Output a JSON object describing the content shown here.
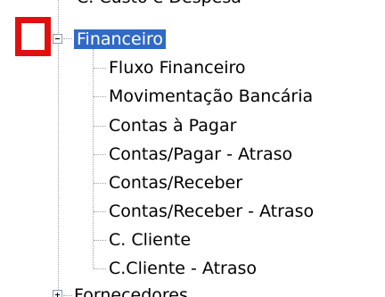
{
  "tree": {
    "top_partial_label": "C. Custo e Despesa",
    "parent": {
      "label": "Financeiro",
      "selected": true,
      "expanded": true
    },
    "children": [
      {
        "label": "Fluxo Financeiro"
      },
      {
        "label": "Movimentação Bancária"
      },
      {
        "label": "Contas à Pagar"
      },
      {
        "label": "Contas/Pagar - Atraso"
      },
      {
        "label": "Contas/Receber"
      },
      {
        "label": "Contas/Receber - Atraso"
      },
      {
        "label": "C. Cliente"
      },
      {
        "label": "C.Cliente - Atraso"
      }
    ],
    "bottom_partial_label": "Fornecedores"
  },
  "colors": {
    "selection": "#316ac5",
    "highlight": "#e01010"
  }
}
